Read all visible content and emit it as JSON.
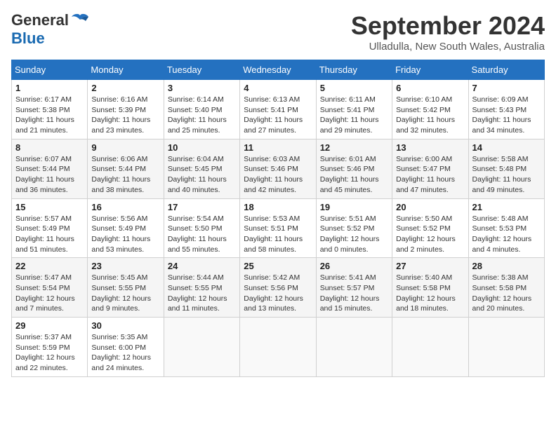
{
  "header": {
    "logo_line1": "General",
    "logo_line2": "Blue",
    "month": "September 2024",
    "location": "Ulladulla, New South Wales, Australia"
  },
  "days_of_week": [
    "Sunday",
    "Monday",
    "Tuesday",
    "Wednesday",
    "Thursday",
    "Friday",
    "Saturday"
  ],
  "weeks": [
    [
      {
        "day": "1",
        "info": "Sunrise: 6:17 AM\nSunset: 5:38 PM\nDaylight: 11 hours\nand 21 minutes."
      },
      {
        "day": "2",
        "info": "Sunrise: 6:16 AM\nSunset: 5:39 PM\nDaylight: 11 hours\nand 23 minutes."
      },
      {
        "day": "3",
        "info": "Sunrise: 6:14 AM\nSunset: 5:40 PM\nDaylight: 11 hours\nand 25 minutes."
      },
      {
        "day": "4",
        "info": "Sunrise: 6:13 AM\nSunset: 5:41 PM\nDaylight: 11 hours\nand 27 minutes."
      },
      {
        "day": "5",
        "info": "Sunrise: 6:11 AM\nSunset: 5:41 PM\nDaylight: 11 hours\nand 29 minutes."
      },
      {
        "day": "6",
        "info": "Sunrise: 6:10 AM\nSunset: 5:42 PM\nDaylight: 11 hours\nand 32 minutes."
      },
      {
        "day": "7",
        "info": "Sunrise: 6:09 AM\nSunset: 5:43 PM\nDaylight: 11 hours\nand 34 minutes."
      }
    ],
    [
      {
        "day": "8",
        "info": "Sunrise: 6:07 AM\nSunset: 5:44 PM\nDaylight: 11 hours\nand 36 minutes."
      },
      {
        "day": "9",
        "info": "Sunrise: 6:06 AM\nSunset: 5:44 PM\nDaylight: 11 hours\nand 38 minutes."
      },
      {
        "day": "10",
        "info": "Sunrise: 6:04 AM\nSunset: 5:45 PM\nDaylight: 11 hours\nand 40 minutes."
      },
      {
        "day": "11",
        "info": "Sunrise: 6:03 AM\nSunset: 5:46 PM\nDaylight: 11 hours\nand 42 minutes."
      },
      {
        "day": "12",
        "info": "Sunrise: 6:01 AM\nSunset: 5:46 PM\nDaylight: 11 hours\nand 45 minutes."
      },
      {
        "day": "13",
        "info": "Sunrise: 6:00 AM\nSunset: 5:47 PM\nDaylight: 11 hours\nand 47 minutes."
      },
      {
        "day": "14",
        "info": "Sunrise: 5:58 AM\nSunset: 5:48 PM\nDaylight: 11 hours\nand 49 minutes."
      }
    ],
    [
      {
        "day": "15",
        "info": "Sunrise: 5:57 AM\nSunset: 5:49 PM\nDaylight: 11 hours\nand 51 minutes."
      },
      {
        "day": "16",
        "info": "Sunrise: 5:56 AM\nSunset: 5:49 PM\nDaylight: 11 hours\nand 53 minutes."
      },
      {
        "day": "17",
        "info": "Sunrise: 5:54 AM\nSunset: 5:50 PM\nDaylight: 11 hours\nand 55 minutes."
      },
      {
        "day": "18",
        "info": "Sunrise: 5:53 AM\nSunset: 5:51 PM\nDaylight: 11 hours\nand 58 minutes."
      },
      {
        "day": "19",
        "info": "Sunrise: 5:51 AM\nSunset: 5:52 PM\nDaylight: 12 hours\nand 0 minutes."
      },
      {
        "day": "20",
        "info": "Sunrise: 5:50 AM\nSunset: 5:52 PM\nDaylight: 12 hours\nand 2 minutes."
      },
      {
        "day": "21",
        "info": "Sunrise: 5:48 AM\nSunset: 5:53 PM\nDaylight: 12 hours\nand 4 minutes."
      }
    ],
    [
      {
        "day": "22",
        "info": "Sunrise: 5:47 AM\nSunset: 5:54 PM\nDaylight: 12 hours\nand 7 minutes."
      },
      {
        "day": "23",
        "info": "Sunrise: 5:45 AM\nSunset: 5:55 PM\nDaylight: 12 hours\nand 9 minutes."
      },
      {
        "day": "24",
        "info": "Sunrise: 5:44 AM\nSunset: 5:55 PM\nDaylight: 12 hours\nand 11 minutes."
      },
      {
        "day": "25",
        "info": "Sunrise: 5:42 AM\nSunset: 5:56 PM\nDaylight: 12 hours\nand 13 minutes."
      },
      {
        "day": "26",
        "info": "Sunrise: 5:41 AM\nSunset: 5:57 PM\nDaylight: 12 hours\nand 15 minutes."
      },
      {
        "day": "27",
        "info": "Sunrise: 5:40 AM\nSunset: 5:58 PM\nDaylight: 12 hours\nand 18 minutes."
      },
      {
        "day": "28",
        "info": "Sunrise: 5:38 AM\nSunset: 5:58 PM\nDaylight: 12 hours\nand 20 minutes."
      }
    ],
    [
      {
        "day": "29",
        "info": "Sunrise: 5:37 AM\nSunset: 5:59 PM\nDaylight: 12 hours\nand 22 minutes."
      },
      {
        "day": "30",
        "info": "Sunrise: 5:35 AM\nSunset: 6:00 PM\nDaylight: 12 hours\nand 24 minutes."
      },
      {
        "day": "",
        "info": ""
      },
      {
        "day": "",
        "info": ""
      },
      {
        "day": "",
        "info": ""
      },
      {
        "day": "",
        "info": ""
      },
      {
        "day": "",
        "info": ""
      }
    ]
  ]
}
